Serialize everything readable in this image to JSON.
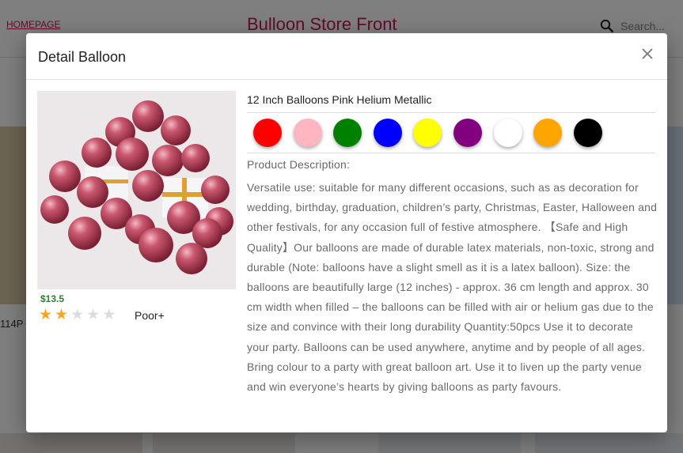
{
  "background": {
    "home_link": "HOMEPAGE",
    "store_title": "Bulloon Store Front",
    "search_placeholder": "Search...",
    "partial_card_text": "114P"
  },
  "modal": {
    "title": "Detail Balloon",
    "close_icon": "close-icon"
  },
  "product": {
    "name": "12 Inch Balloons Pink Helium Metallic",
    "price": "$13.5",
    "rating": 2,
    "rating_max": 5,
    "rating_label": "Poor+",
    "colors": [
      "#ff0000",
      "#ffb6c1",
      "#008000",
      "#0000ff",
      "#ffff00",
      "#800080",
      "#ffffff",
      "#ffa500",
      "#000000"
    ],
    "description_label": "Product Description:",
    "description": "Versatile use: suitable for many different occasions, such as as decoration for wedding, birthday, graduation, children’s party, Christmas, Easter, Halloween and other festivals, for any occasion full of festive atmosphere. 【Safe and High Quality】Our balloons are made of durable latex materials, non-toxic, strong and durable (Note: balloons have a slight smell as it is a latex balloon). Size: the balloons are beautifully large (12 inches) - approx. 36 cm length and approx. 30 cm width when filled – the balloons can be filled with air or helium gas due to the size and convince with their long durability Quantity:50pcs Use it to decorate your party. Balloons can be used anywhere, anytime and by people of all ages. Bring colour to a party with great balloon art. Use it to liven up the party venue and win everyone’s hearts by giving balloons as party favours."
  }
}
